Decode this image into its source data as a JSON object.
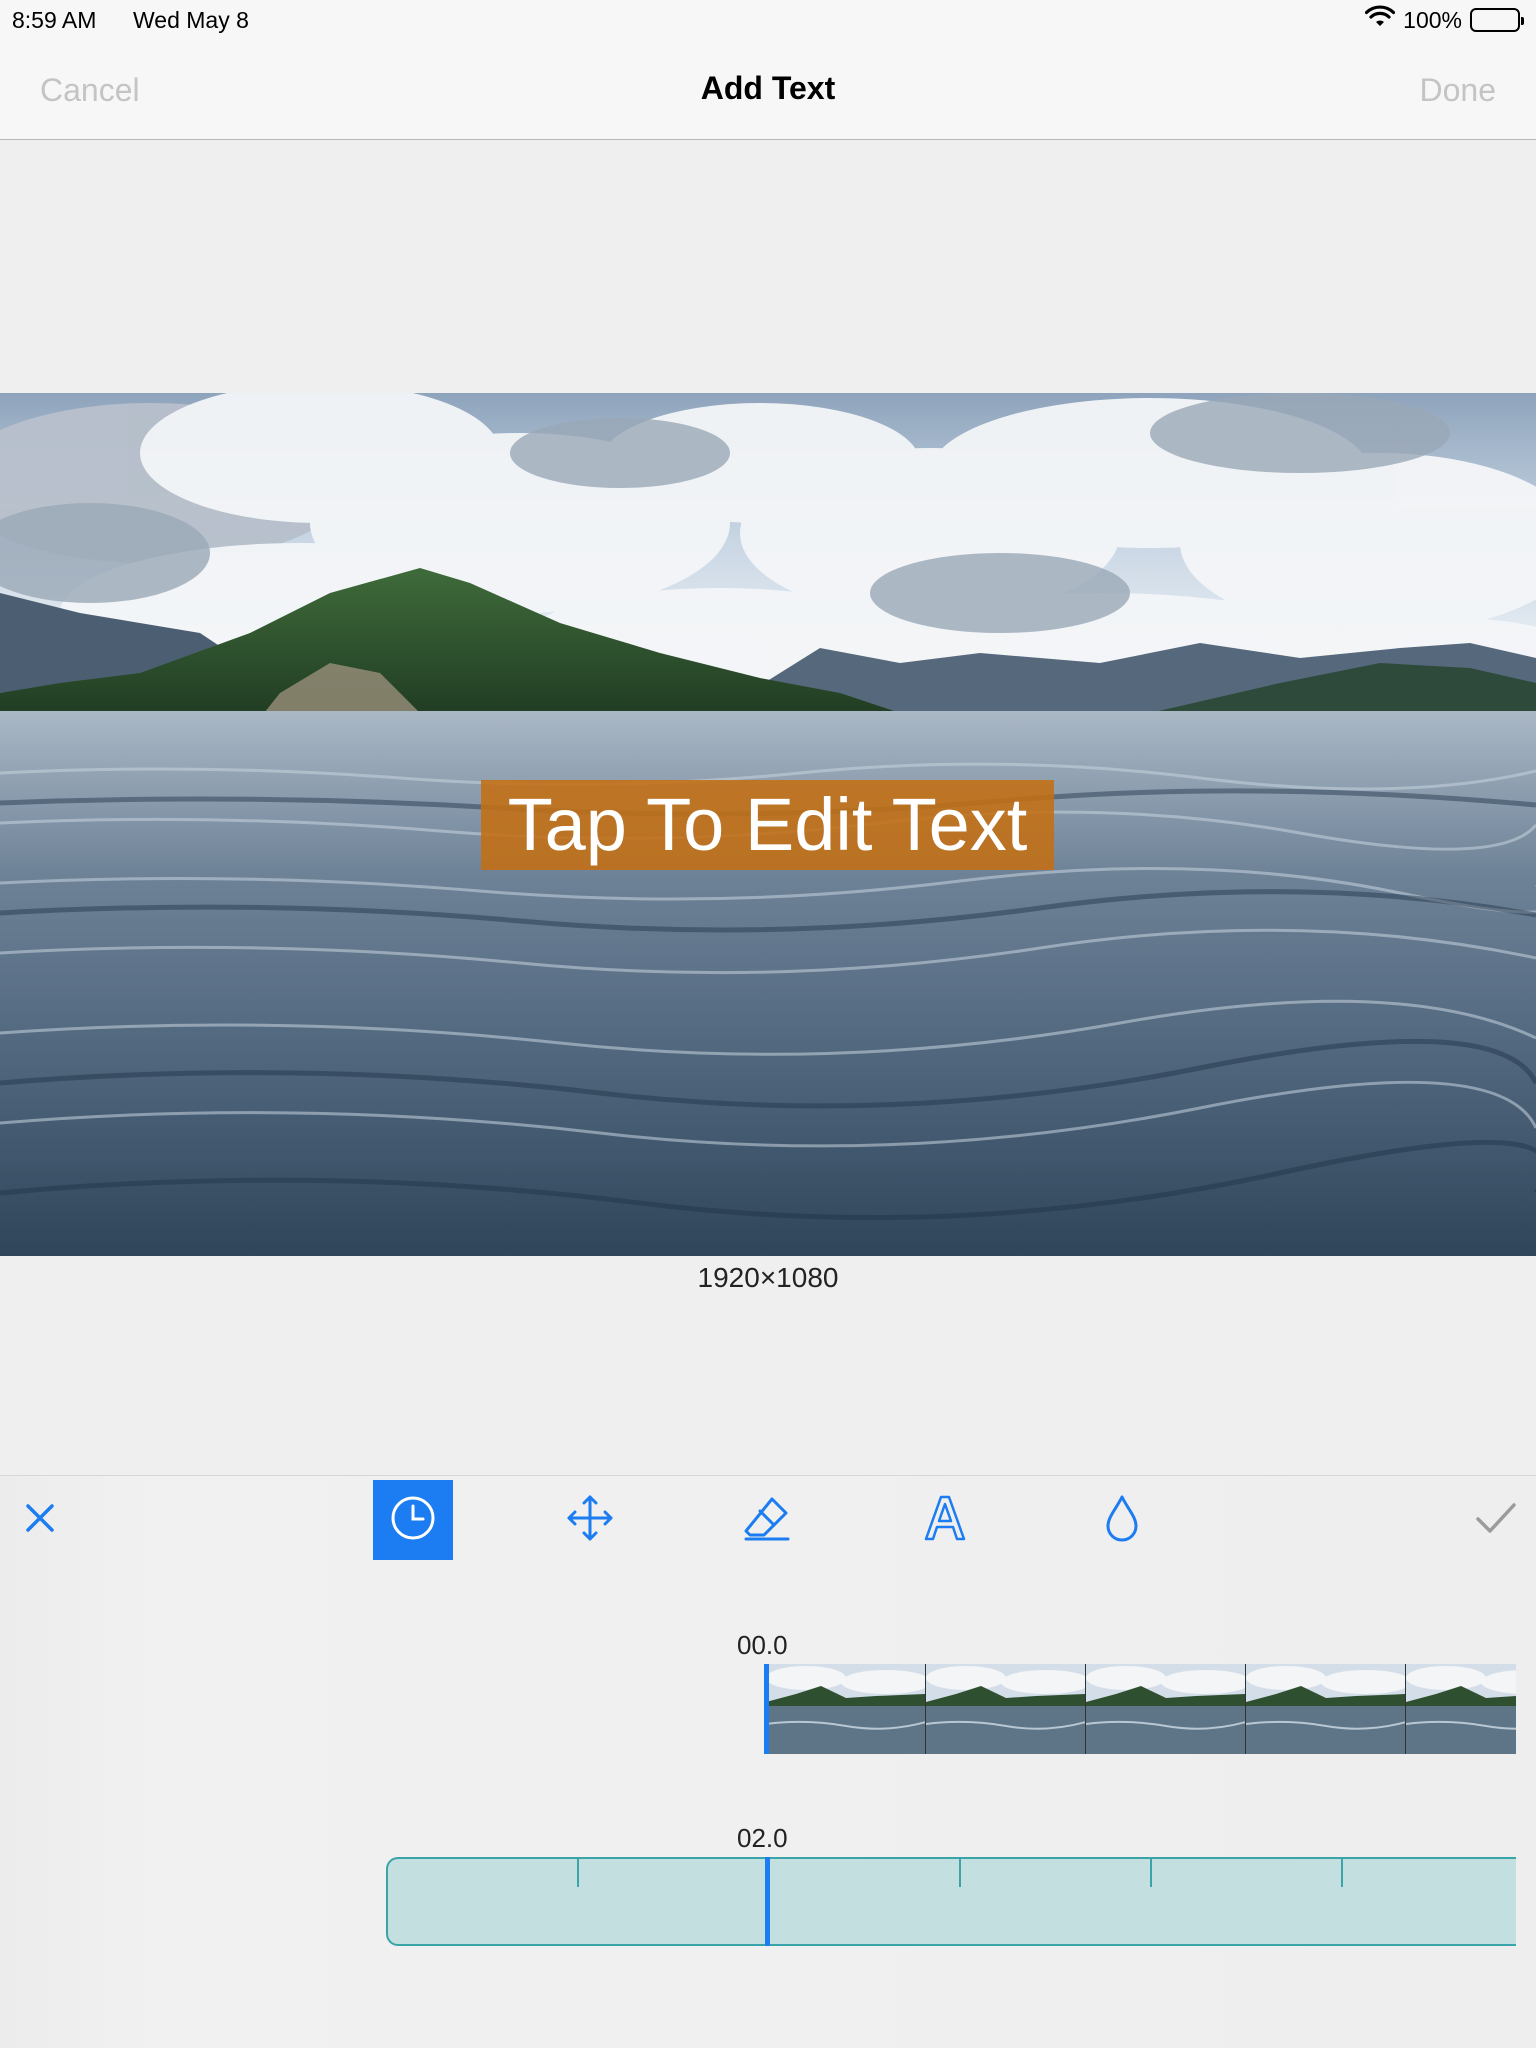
{
  "status_bar": {
    "time": "8:59 AM",
    "date": "Wed May 8",
    "battery": "100%"
  },
  "nav": {
    "cancel": "Cancel",
    "title": "Add Text",
    "done": "Done"
  },
  "preview": {
    "overlay_text": "Tap To Edit Text",
    "resolution": "1920×1080"
  },
  "toolbar": {
    "tools": [
      "close-icon",
      "clock-icon",
      "move-icon",
      "eraser-icon",
      "font-icon",
      "opacity-icon",
      "checkmark-icon"
    ],
    "active_tool": "clock-icon",
    "accent": "#1c7cf1"
  },
  "timeline": {
    "top_time": "00.0",
    "bottom_time": "02.0"
  }
}
